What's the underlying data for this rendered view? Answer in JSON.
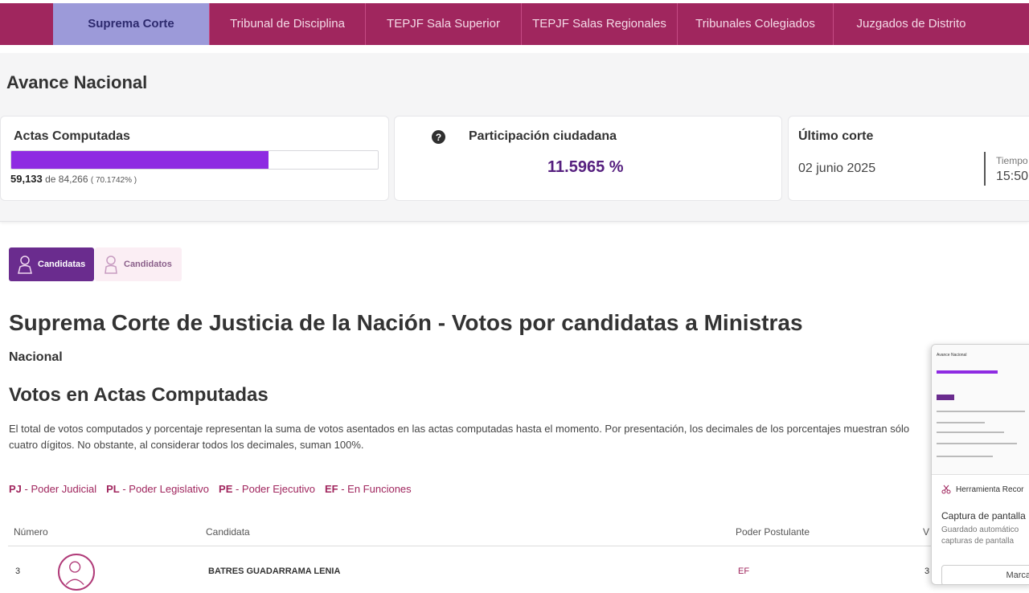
{
  "nav": {
    "tabs": [
      {
        "label": "Suprema Corte",
        "active": true
      },
      {
        "label": "Tribunal de Disciplina"
      },
      {
        "label": "TEPJF Sala Superior"
      },
      {
        "label": "TEPJF Salas Regionales"
      },
      {
        "label": "Tribunales Colegiados"
      },
      {
        "label": "Juzgados de Distrito"
      }
    ]
  },
  "avance": {
    "title": "Avance Nacional",
    "actas": {
      "label": "Actas Computadas",
      "computed": "59,133",
      "of_text": "de 84,266",
      "percent_text": "( 70.1742% )",
      "progress_fraction": 0.7017
    },
    "participacion": {
      "label": "Participación ciudadana",
      "value": "11.5965 %"
    },
    "corte": {
      "label": "Último corte",
      "date": "02 junio 2025",
      "tiempo_label": "Tiempo",
      "tiempo_value": "15:50"
    }
  },
  "toggle": {
    "candidatas": "Candidatas",
    "candidatos": "Candidatos"
  },
  "section": {
    "title": "Suprema Corte de Justicia de la Nación - Votos por candidatas a Ministras",
    "scope": "Nacional",
    "subtitle": "Votos en Actas Computadas",
    "note": "El total de votos computados y porcentaje representan la suma de votos asentados en las actas computadas hasta el momento. Por presentación, los decimales de los porcentajes muestran sólo cuatro dígitos. No obstante, al considerar todos los decimales, suman 100%."
  },
  "legend": [
    {
      "code": "PJ",
      "text": " - Poder Judicial"
    },
    {
      "code": "PL",
      "text": " - Poder Legislativo"
    },
    {
      "code": "PE",
      "text": " - Poder Ejecutivo"
    },
    {
      "code": "EF",
      "text": " - En Funciones"
    }
  ],
  "table": {
    "headers": {
      "numero": "Número",
      "candidata": "Candidata",
      "poder": "Poder Postulante",
      "votos": "V"
    },
    "rows": [
      {
        "numero": "3",
        "candidata": "BATRES GUADARRAMA LENIA",
        "poder": "EF",
        "votos": "3"
      }
    ]
  },
  "snip": {
    "thumb_title": "Avance Nacional",
    "tool_label": "Herramienta Recor",
    "title": "Captura de pantalla",
    "desc": "Guardado automático capturas de pantalla",
    "button": "Marca"
  },
  "colors": {
    "primary": "#a0265e",
    "active_tab": "#9c9ad9",
    "progress": "#8e2be2",
    "accent": "#6a2c8e"
  }
}
